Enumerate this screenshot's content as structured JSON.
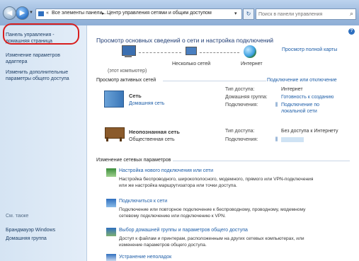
{
  "titlebar": {
    "breadcrumb_root": "Все элементы панели...",
    "breadcrumb_current": "Центр управления сетями и общим доступом",
    "search_placeholder": "Поиск в панели управления"
  },
  "sidebar": {
    "items": [
      {
        "label": "Панель управления -"
      },
      {
        "label": "домашняя страница"
      },
      {
        "label": "Изменение параметров"
      },
      {
        "label": "адаптера"
      },
      {
        "label": "Изменить дополнительные"
      },
      {
        "label": "параметры общего доступа"
      }
    ],
    "see_also": "См. также",
    "bottom_items": [
      {
        "label": "Брандмауэр Windows"
      },
      {
        "label": "Домашняя группа"
      }
    ]
  },
  "main": {
    "title": "Просмотр основных сведений о сети и настройка подключений",
    "full_map": "Просмотр полной карты",
    "map": {
      "computer": "(этот компьютер)",
      "middle": "Несколько сетей",
      "internet": "Интернет"
    },
    "active_networks_title": "Просмотр активных сетей",
    "connect_disconnect": "Подключение или отключение",
    "network1": {
      "name": "Сеть",
      "type": "Домашняя сеть",
      "access_label": "Тип доступа:",
      "access_value": "Интернет",
      "homegroup_label": "Домашняя группа:",
      "homegroup_value": "Готовность к созданию",
      "connections_label": "Подключения:",
      "connections_value": "Подключение по",
      "connections_value2": "локальной сети"
    },
    "network2": {
      "name": "Неопознанная сеть",
      "type": "Общественная сеть",
      "access_label": "Тип доступа:",
      "access_value": "Без доступа к Интернету",
      "connections_label": "Подключения:"
    },
    "change_settings_title": "Изменение сетевых параметров",
    "tasks": [
      {
        "title": "Настройка нового подключения или сети",
        "desc1": "Настройка беспроводного, широкополосного, модемного, прямого или VPN-подключения",
        "desc2": "или же настройка маршрутизатора или точки доступа."
      },
      {
        "title": "Подключиться к сети",
        "desc1": "Подключение или повторное подключение к беспроводному, проводному, модемному",
        "desc2": "сетевому подключению или подключению к VPN."
      },
      {
        "title": "Выбор домашней группы и параметров общего доступа",
        "desc1": "Доступ к файлам и принтерам, расположенным на других сетевых компьютерах, или",
        "desc2": "изменение параметров общего доступа."
      },
      {
        "title": "Устранение неполадок"
      }
    ]
  }
}
